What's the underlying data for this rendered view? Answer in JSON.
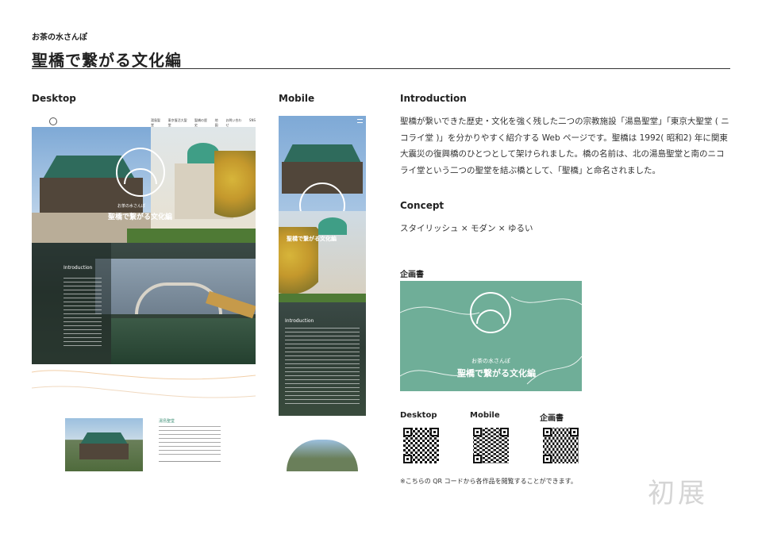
{
  "header": {
    "brand": "お茶の水さんぽ",
    "title": "聖橋で繋がる文化編"
  },
  "desktop": {
    "label": "Desktop",
    "nav_items": [
      "湯島聖堂",
      "東京復活大聖堂",
      "聖橋の歴史",
      "地図",
      "お問い合わせ",
      "SNS"
    ],
    "hero_brand": "お茶の水さんぽ",
    "hero_title": "聖橋で繋がる文化編",
    "intro_heading": "Introduction",
    "section2_heading": "湯島聖堂"
  },
  "mobile": {
    "label": "Mobile",
    "hero_title": "聖橋で繋がる文化編",
    "intro_heading": "Introduction"
  },
  "introduction": {
    "heading": "Introduction",
    "body": "聖橋が繋いできた歴史・文化を強く残した二つの宗教施設「湯島聖堂」「東京大聖堂 ( ニコライ堂 )」を分かりやすく紹介する Web ページです。聖橋は 1992( 昭和2) 年に関東大震災の復興橋のひとつとして架けられました。橋の名前は、北の湯島聖堂と南のニコライ堂という二つの聖堂を結ぶ橋として、｢聖橋｣ と命名されました。"
  },
  "concept": {
    "heading": "Concept",
    "body": "スタイリッシュ × モダン × ゆるい"
  },
  "proposal": {
    "heading": "企画書",
    "brand": "お茶の水さんぽ",
    "title": "聖橋で繋がる文化編",
    "color": "#6fae98"
  },
  "qr": {
    "labels": [
      "Desktop",
      "Mobile",
      "企画書"
    ],
    "note": "※こちらの QR コードから各作品を閲覧することができます。"
  },
  "watermark": "初展"
}
